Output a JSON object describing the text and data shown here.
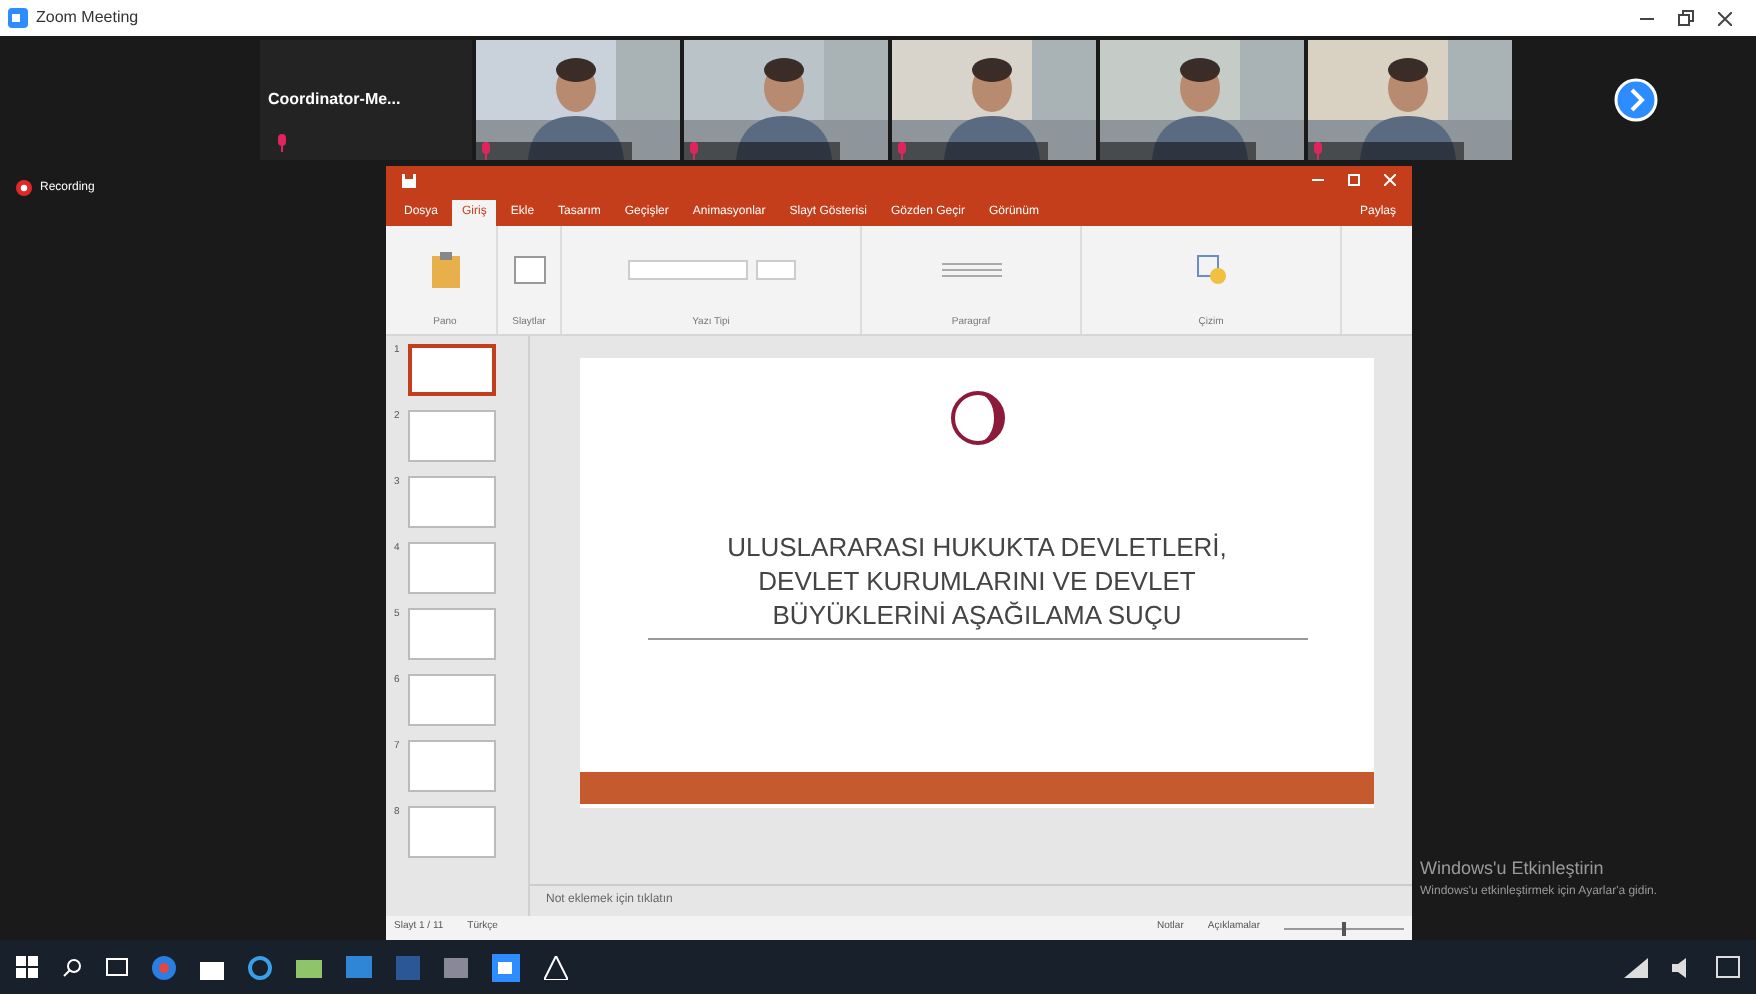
{
  "window": {
    "title": "Zoom Meeting"
  },
  "participants": [
    {
      "kind": "name",
      "name": "Coordinator-Me...",
      "muted": true
    },
    {
      "kind": "video",
      "muted": true
    },
    {
      "kind": "video",
      "muted": true
    },
    {
      "kind": "video",
      "muted": true
    },
    {
      "kind": "video",
      "muted": false
    },
    {
      "kind": "video",
      "muted": true
    }
  ],
  "recording": {
    "label": "Recording"
  },
  "powerpoint": {
    "tabs": [
      {
        "label": "Dosya",
        "selected": false
      },
      {
        "label": "Giriş",
        "selected": true
      },
      {
        "label": "Ekle",
        "selected": false
      },
      {
        "label": "Tasarım",
        "selected": false
      },
      {
        "label": "Geçişler",
        "selected": false
      },
      {
        "label": "Animasyonlar",
        "selected": false
      },
      {
        "label": "Slayt Gösterisi",
        "selected": false
      },
      {
        "label": "Gözden Geçir",
        "selected": false
      },
      {
        "label": "Görünüm",
        "selected": false
      }
    ],
    "share": "Paylaş",
    "ribbon_groups": [
      "Pano",
      "Slaytlar",
      "Yazı Tipi",
      "Paragraf",
      "Çizim"
    ],
    "thumbnails": [
      {
        "number": "1",
        "selected": true
      },
      {
        "number": "2",
        "selected": false
      },
      {
        "number": "3",
        "selected": false
      },
      {
        "number": "4",
        "selected": false
      },
      {
        "number": "5",
        "selected": false
      },
      {
        "number": "6",
        "selected": false
      },
      {
        "number": "7",
        "selected": false
      },
      {
        "number": "8",
        "selected": false
      }
    ],
    "slide": {
      "title": [
        "ULUSLARARASI HUKUKTA DEVLETLERİ,",
        "DEVLET KURUMLARINI VE DEVLET",
        "BÜYÜKLERİNİ AŞAĞILAMA SUÇU"
      ]
    },
    "notes": {
      "placeholder": "Not eklemek için tıklatın"
    },
    "status": {
      "slide": "Slayt 1 / 11",
      "language": "Türkçe",
      "notes": "Notlar",
      "comments": "Açıklamalar",
      "zoom": {
        "level": 0.5
      }
    }
  },
  "activation": {
    "title": "Windows'u Etkinleştirin",
    "subtitle": "Windows'u etkinleştirmek için Ayarlar'a gidin."
  }
}
